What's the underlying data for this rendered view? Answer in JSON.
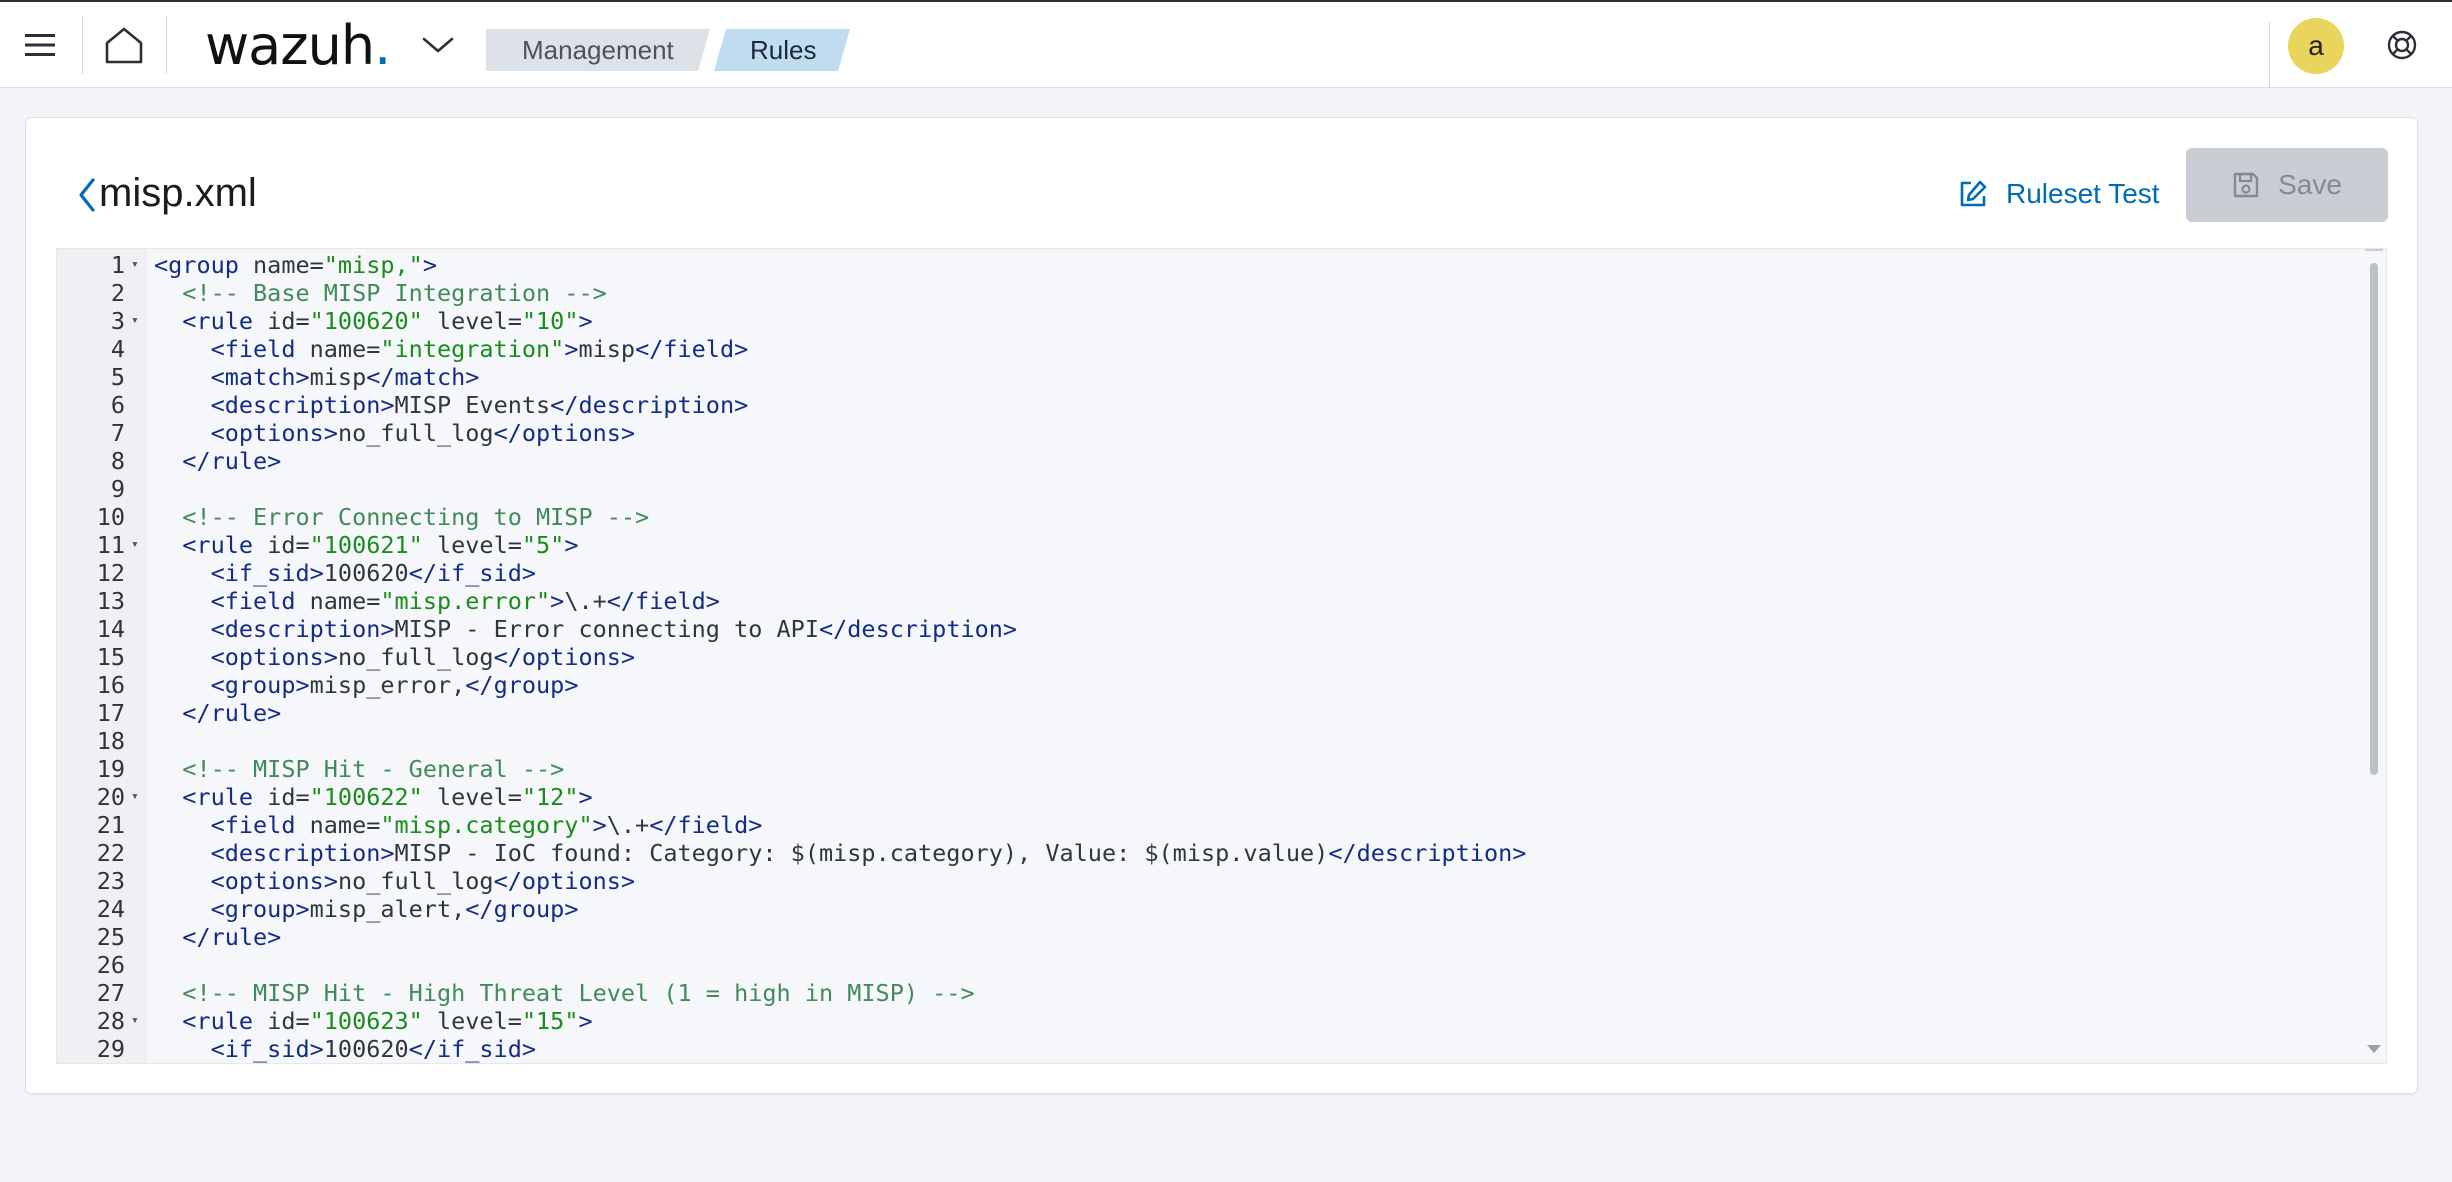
{
  "header": {
    "logo_text": "wazuh",
    "logo_dot": ".",
    "breadcrumbs": [
      "Management",
      "Rules"
    ],
    "avatar_initial": "a",
    "icons": {
      "menu": "menu-icon",
      "home": "home-icon",
      "dropdown": "chevron-down-icon",
      "help": "help-lifebuoy-icon"
    }
  },
  "file": {
    "name": "misp.xml",
    "ruleset_test_label": "Ruleset Test",
    "save_label": "Save"
  },
  "colors": {
    "accent": "#006bb8",
    "avatar": "#ead55c",
    "tag": "#152c86",
    "attr_value": "#1a8c1a",
    "comment": "#43895b"
  },
  "editor": {
    "lines": [
      {
        "n": "1",
        "fold": true,
        "tokens": [
          [
            "tg",
            "<group"
          ],
          [
            "an",
            " name="
          ],
          [
            "av",
            "\"misp,\""
          ],
          [
            "tg",
            ">"
          ]
        ]
      },
      {
        "n": "2",
        "fold": false,
        "tokens": [
          [
            "cm",
            "  <!-- Base MISP Integration -->"
          ]
        ]
      },
      {
        "n": "3",
        "fold": true,
        "tokens": [
          [
            "an",
            "  "
          ],
          [
            "tg",
            "<rule"
          ],
          [
            "an",
            " id="
          ],
          [
            "av",
            "\"100620\""
          ],
          [
            "an",
            " level="
          ],
          [
            "av",
            "\"10\""
          ],
          [
            "tg",
            ">"
          ]
        ]
      },
      {
        "n": "4",
        "fold": false,
        "tokens": [
          [
            "an",
            "    "
          ],
          [
            "tg",
            "<field"
          ],
          [
            "an",
            " name="
          ],
          [
            "av",
            "\"integration\""
          ],
          [
            "tg",
            ">"
          ],
          [
            "an",
            "misp"
          ],
          [
            "tg",
            "</field>"
          ]
        ]
      },
      {
        "n": "5",
        "fold": false,
        "tokens": [
          [
            "an",
            "    "
          ],
          [
            "tg",
            "<match>"
          ],
          [
            "an",
            "misp"
          ],
          [
            "tg",
            "</match>"
          ]
        ]
      },
      {
        "n": "6",
        "fold": false,
        "tokens": [
          [
            "an",
            "    "
          ],
          [
            "tg",
            "<description>"
          ],
          [
            "an",
            "MISP Events"
          ],
          [
            "tg",
            "</description>"
          ]
        ]
      },
      {
        "n": "7",
        "fold": false,
        "tokens": [
          [
            "an",
            "    "
          ],
          [
            "tg",
            "<options>"
          ],
          [
            "an",
            "no_full_log"
          ],
          [
            "tg",
            "</options>"
          ]
        ]
      },
      {
        "n": "8",
        "fold": false,
        "tokens": [
          [
            "an",
            "  "
          ],
          [
            "tg",
            "</rule>"
          ]
        ]
      },
      {
        "n": "9",
        "fold": false,
        "tokens": []
      },
      {
        "n": "10",
        "fold": false,
        "tokens": [
          [
            "cm",
            "  <!-- Error Connecting to MISP -->"
          ]
        ]
      },
      {
        "n": "11",
        "fold": true,
        "tokens": [
          [
            "an",
            "  "
          ],
          [
            "tg",
            "<rule"
          ],
          [
            "an",
            " id="
          ],
          [
            "av",
            "\"100621\""
          ],
          [
            "an",
            " level="
          ],
          [
            "av",
            "\"5\""
          ],
          [
            "tg",
            ">"
          ]
        ]
      },
      {
        "n": "12",
        "fold": false,
        "tokens": [
          [
            "an",
            "    "
          ],
          [
            "tg",
            "<if_sid>"
          ],
          [
            "an",
            "100620"
          ],
          [
            "tg",
            "</if_sid>"
          ]
        ]
      },
      {
        "n": "13",
        "fold": false,
        "tokens": [
          [
            "an",
            "    "
          ],
          [
            "tg",
            "<field"
          ],
          [
            "an",
            " name="
          ],
          [
            "av",
            "\"misp.error\""
          ],
          [
            "tg",
            ">"
          ],
          [
            "an",
            "\\.+"
          ],
          [
            "tg",
            "</field>"
          ]
        ]
      },
      {
        "n": "14",
        "fold": false,
        "tokens": [
          [
            "an",
            "    "
          ],
          [
            "tg",
            "<description>"
          ],
          [
            "an",
            "MISP - Error connecting to API"
          ],
          [
            "tg",
            "</description>"
          ]
        ]
      },
      {
        "n": "15",
        "fold": false,
        "tokens": [
          [
            "an",
            "    "
          ],
          [
            "tg",
            "<options>"
          ],
          [
            "an",
            "no_full_log"
          ],
          [
            "tg",
            "</options>"
          ]
        ]
      },
      {
        "n": "16",
        "fold": false,
        "tokens": [
          [
            "an",
            "    "
          ],
          [
            "tg",
            "<group>"
          ],
          [
            "an",
            "misp_error,"
          ],
          [
            "tg",
            "</group>"
          ]
        ]
      },
      {
        "n": "17",
        "fold": false,
        "tokens": [
          [
            "an",
            "  "
          ],
          [
            "tg",
            "</rule>"
          ]
        ]
      },
      {
        "n": "18",
        "fold": false,
        "tokens": []
      },
      {
        "n": "19",
        "fold": false,
        "tokens": [
          [
            "cm",
            "  <!-- MISP Hit - General -->"
          ]
        ]
      },
      {
        "n": "20",
        "fold": true,
        "tokens": [
          [
            "an",
            "  "
          ],
          [
            "tg",
            "<rule"
          ],
          [
            "an",
            " id="
          ],
          [
            "av",
            "\"100622\""
          ],
          [
            "an",
            " level="
          ],
          [
            "av",
            "\"12\""
          ],
          [
            "tg",
            ">"
          ]
        ]
      },
      {
        "n": "21",
        "fold": false,
        "tokens": [
          [
            "an",
            "    "
          ],
          [
            "tg",
            "<field"
          ],
          [
            "an",
            " name="
          ],
          [
            "av",
            "\"misp.category\""
          ],
          [
            "tg",
            ">"
          ],
          [
            "an",
            "\\.+"
          ],
          [
            "tg",
            "</field>"
          ]
        ]
      },
      {
        "n": "22",
        "fold": false,
        "tokens": [
          [
            "an",
            "    "
          ],
          [
            "tg",
            "<description>"
          ],
          [
            "an",
            "MISP - IoC found: Category: $(misp.category), Value: $(misp.value)"
          ],
          [
            "tg",
            "</description>"
          ]
        ]
      },
      {
        "n": "23",
        "fold": false,
        "tokens": [
          [
            "an",
            "    "
          ],
          [
            "tg",
            "<options>"
          ],
          [
            "an",
            "no_full_log"
          ],
          [
            "tg",
            "</options>"
          ]
        ]
      },
      {
        "n": "24",
        "fold": false,
        "tokens": [
          [
            "an",
            "    "
          ],
          [
            "tg",
            "<group>"
          ],
          [
            "an",
            "misp_alert,"
          ],
          [
            "tg",
            "</group>"
          ]
        ]
      },
      {
        "n": "25",
        "fold": false,
        "tokens": [
          [
            "an",
            "  "
          ],
          [
            "tg",
            "</rule>"
          ]
        ]
      },
      {
        "n": "26",
        "fold": false,
        "tokens": []
      },
      {
        "n": "27",
        "fold": false,
        "tokens": [
          [
            "cm",
            "  <!-- MISP Hit - High Threat Level (1 = high in MISP) -->"
          ]
        ]
      },
      {
        "n": "28",
        "fold": true,
        "tokens": [
          [
            "an",
            "  "
          ],
          [
            "tg",
            "<rule"
          ],
          [
            "an",
            " id="
          ],
          [
            "av",
            "\"100623\""
          ],
          [
            "an",
            " level="
          ],
          [
            "av",
            "\"15\""
          ],
          [
            "tg",
            ">"
          ]
        ]
      },
      {
        "n": "29",
        "fold": false,
        "tokens": [
          [
            "an",
            "    "
          ],
          [
            "tg",
            "<if_sid>"
          ],
          [
            "an",
            "100620"
          ],
          [
            "tg",
            "</if_sid>"
          ]
        ]
      }
    ]
  }
}
